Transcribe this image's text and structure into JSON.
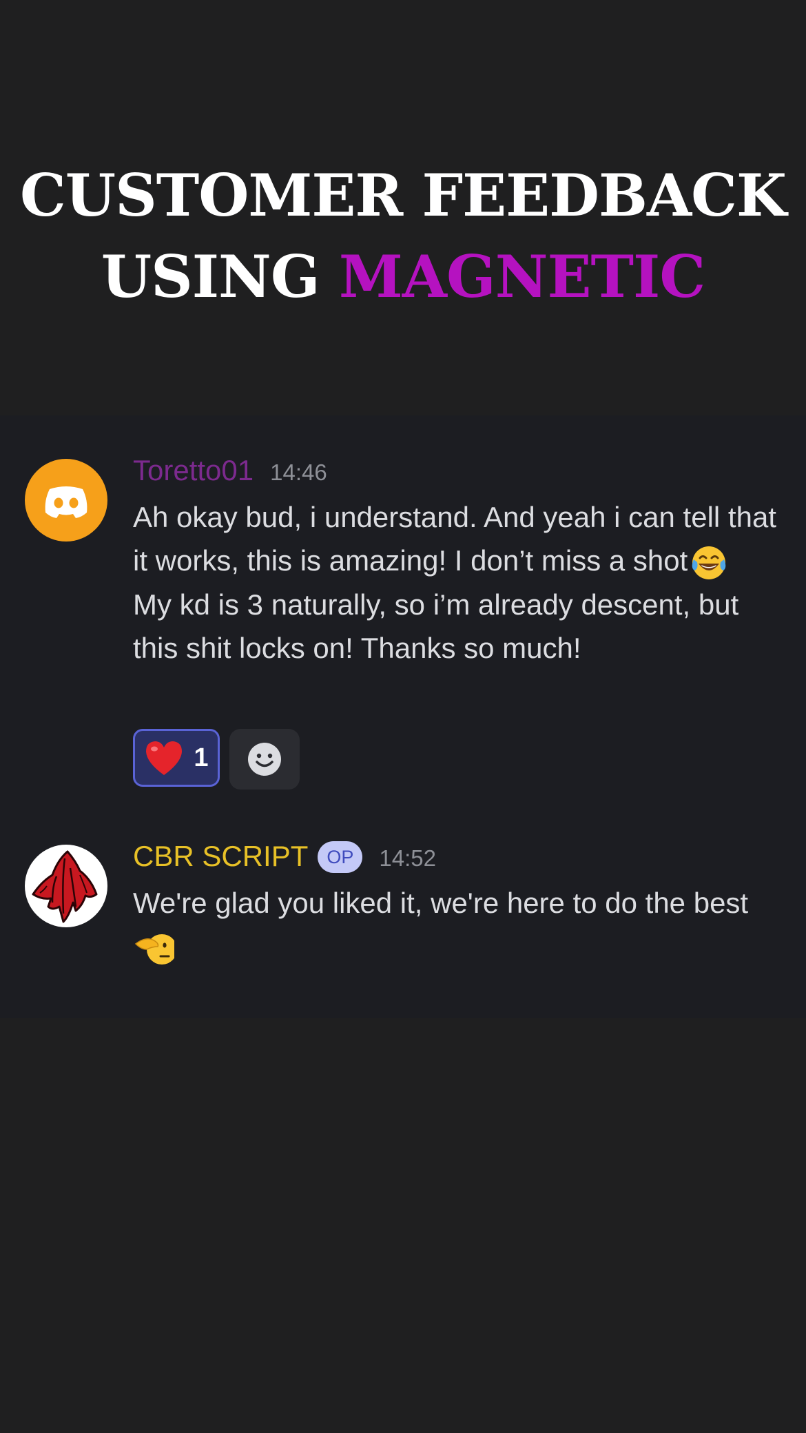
{
  "headline": {
    "line1": "CUSTOMER FEEDBACK",
    "line2_prefix": "USING ",
    "line2_accent": "MAGNETIC"
  },
  "messages": [
    {
      "username": "Toretto01",
      "time": "14:46",
      "avatar_icon": "discord-logo-icon",
      "text": "Ah okay bud, i understand. And yeah i can tell that it works, this is amazing! I don’t miss a shot",
      "text_continued": "My kd is 3 naturally, so i’m already descent, but this shit locks on! Thanks so much!",
      "inline_emoji": "tears-of-joy-emoji",
      "reactions": [
        {
          "emoji": "red-heart",
          "count": "1"
        }
      ]
    },
    {
      "username": "CBR SCRIPT",
      "badge": "OP",
      "time": "14:52",
      "avatar_icon": "red-cloth-avatar",
      "text": "We're glad you liked it, we're here to do the best",
      "inline_emoji": "saluting-face-emoji"
    }
  ],
  "colors": {
    "page_bg": "#1f1f20",
    "chat_bg": "#1c1d22",
    "accent": "#b512c0",
    "username_1": "#7c2a8e",
    "username_2": "#e8c127",
    "badge_bg": "#c4c9f7",
    "reaction_border": "#5a63d6"
  }
}
